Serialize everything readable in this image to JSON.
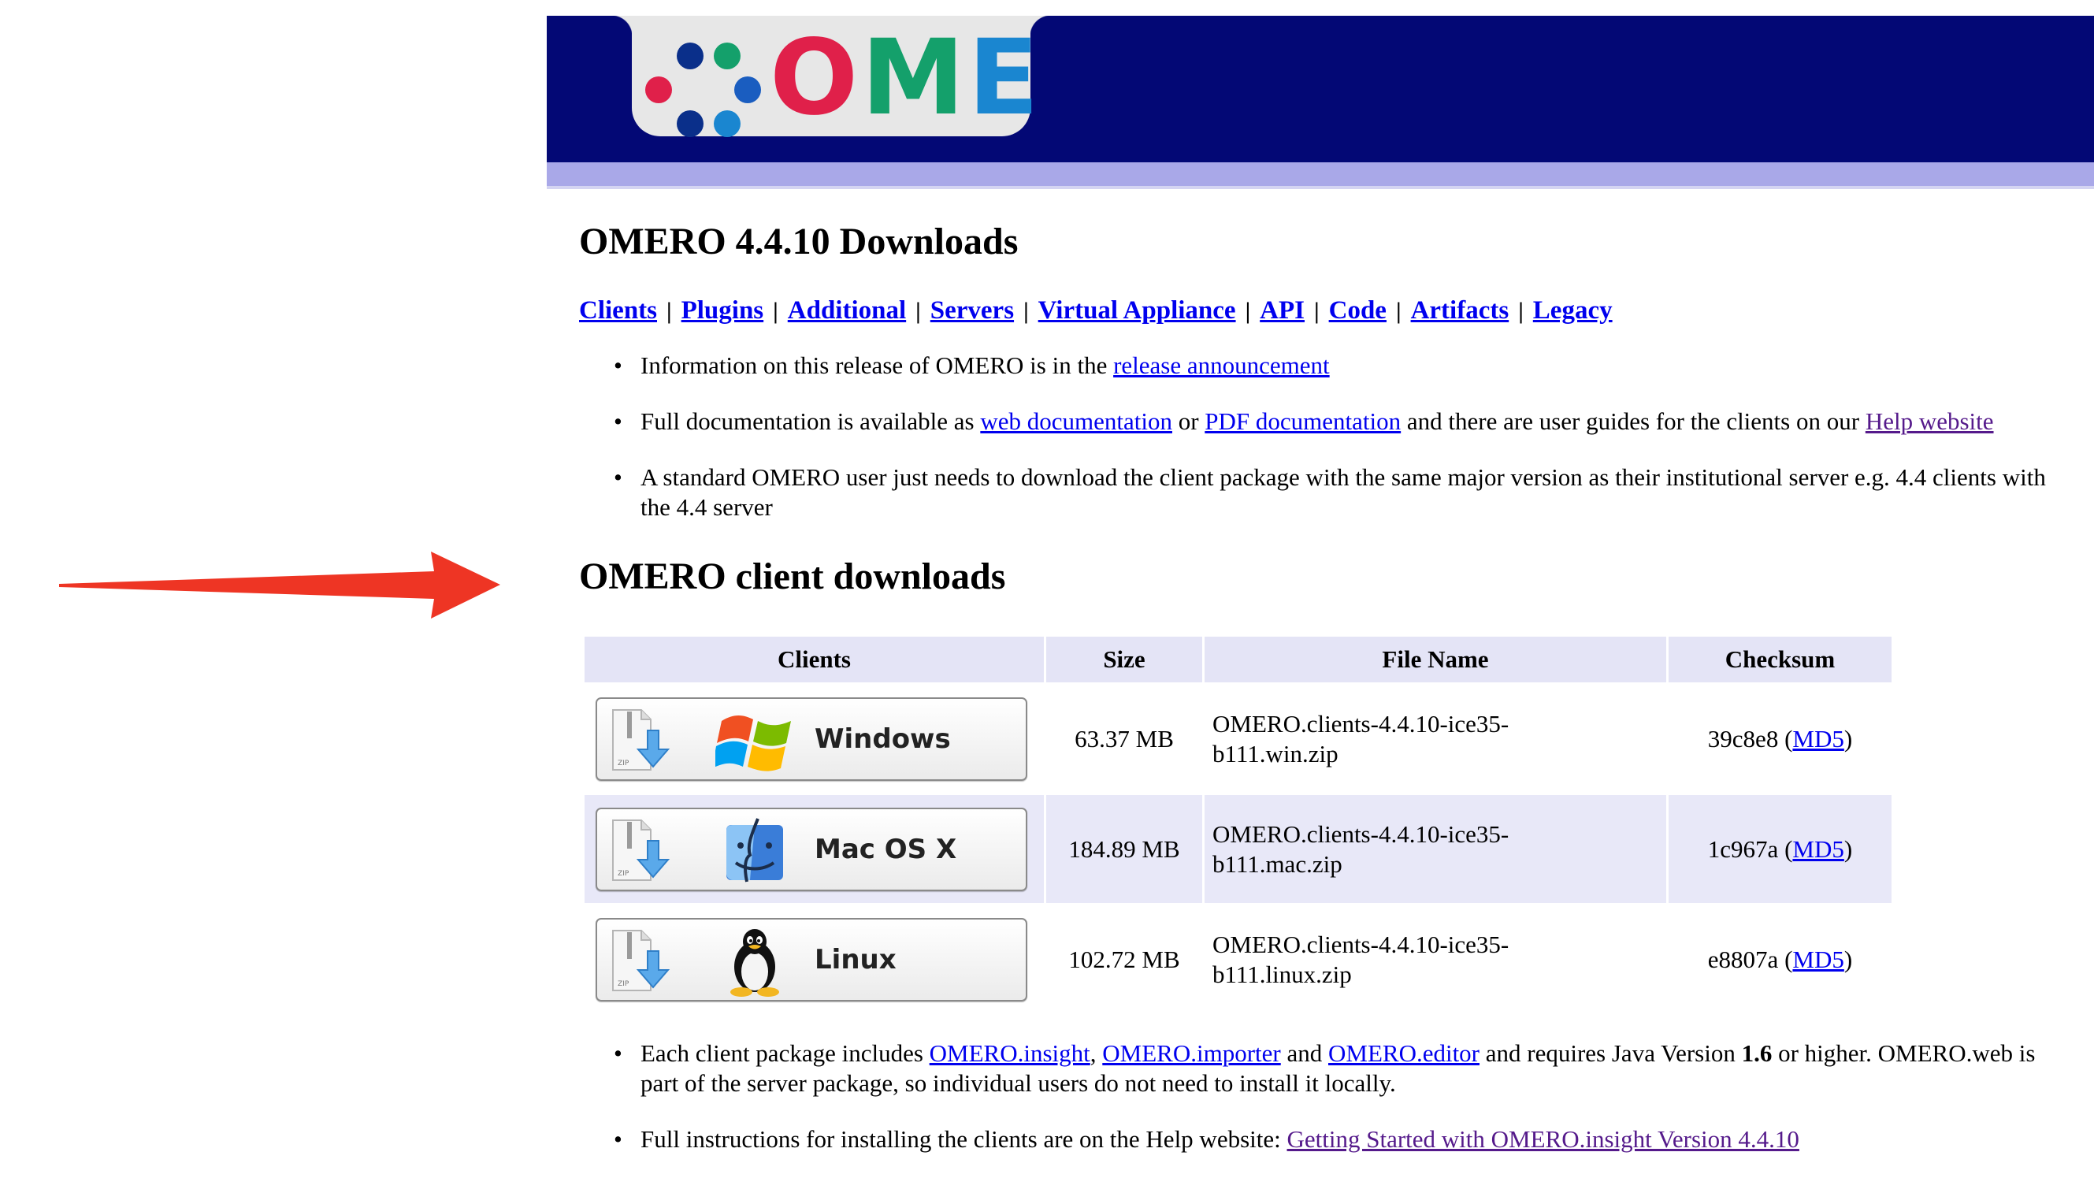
{
  "logo": {
    "text_o": "O",
    "text_m": "M",
    "text_e": "E"
  },
  "colors": {
    "header": "#030875",
    "header_stripe": "#a9a8e8",
    "link": "#0000ee",
    "visited_link": "#551a8b",
    "arrow": "#ee3524",
    "logo_red": "#e0204a",
    "logo_green": "#14a06b",
    "logo_blue": "#1a86d0"
  },
  "title": "OMERO 4.4.10 Downloads",
  "nav": {
    "items": [
      "Clients",
      "Plugins",
      "Additional",
      "Servers",
      "Virtual Appliance",
      "API",
      "Code",
      "Artifacts",
      "Legacy"
    ],
    "separator": "|"
  },
  "info": {
    "release": {
      "text": "Information on this release of OMERO is in the ",
      "link": "release announcement"
    },
    "docs": {
      "t1": "Full documentation is available as ",
      "link1": "web documentation",
      "t2": " or ",
      "link2": "PDF documentation",
      "t3": " and there are user guides for the clients on our ",
      "link3": "Help website"
    },
    "standard": "A standard OMERO user just needs to download the client package with the same major version as their institutional server e.g. 4.4 clients with the 4.4 server"
  },
  "client_heading": "OMERO client downloads",
  "table": {
    "headers": {
      "clients": "Clients",
      "size": "Size",
      "file": "File Name",
      "checksum": "Checksum"
    },
    "rows": [
      {
        "os": "Windows",
        "icon": "windows-logo-icon",
        "size": "63.37 MB",
        "file1": "OMERO.clients-4.4.10-ice35-",
        "file2": "b111.win.zip",
        "hash": "39c8e8",
        "open": " (",
        "link": "MD5",
        "close": ")"
      },
      {
        "os": "Mac OS X",
        "icon": "mac-finder-icon",
        "size": "184.89 MB",
        "file1": "OMERO.clients-4.4.10-ice35-",
        "file2": "b111.mac.zip",
        "hash": "1c967a",
        "open": " (",
        "link": "MD5",
        "close": ")"
      },
      {
        "os": "Linux",
        "icon": "linux-tux-icon",
        "size": "102.72 MB",
        "file1": "OMERO.clients-4.4.10-ice35-",
        "file2": "b111.linux.zip",
        "hash": "e8807a",
        "open": " (",
        "link": "MD5",
        "close": ")"
      }
    ],
    "zip_label": "ZIP"
  },
  "footer": {
    "includes": {
      "t1": "Each client package includes ",
      "link1": "OMERO.insight",
      "t2": ", ",
      "link2": "OMERO.importer",
      "t3": " and ",
      "link3": "OMERO.editor",
      "t4": " and requires Java Version ",
      "java": "1.6",
      "t5": " or higher. OMERO.web is part of the server package, so individual users do not need to install it locally."
    },
    "instructions": {
      "text": "Full instructions for installing the clients are on the Help website: ",
      "link": "Getting Started with OMERO.insight Version 4.4.10"
    }
  }
}
